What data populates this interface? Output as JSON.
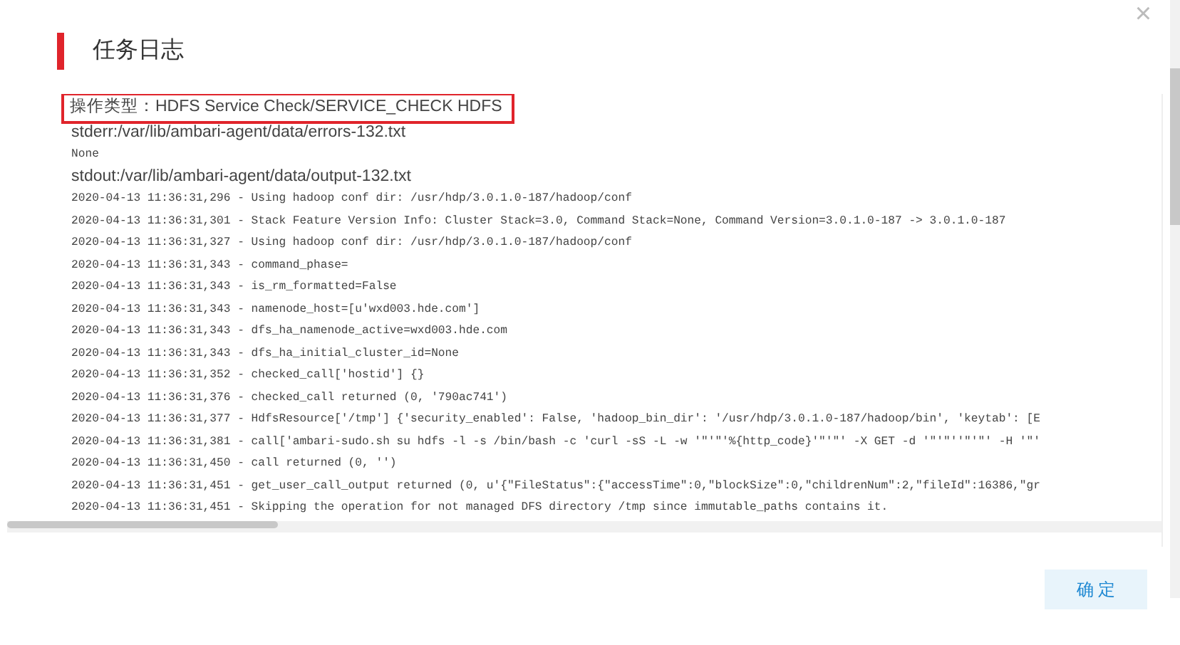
{
  "dialog": {
    "title": "任务日志",
    "close": "×"
  },
  "log": {
    "lines": [
      {
        "kind": "sans",
        "text": "操作类型：HDFS Service Check/SERVICE_CHECK HDFS",
        "highlighted": true
      },
      {
        "kind": "sans",
        "text": "stderr:/var/lib/ambari-agent/data/errors-132.txt",
        "highlighted": false
      },
      {
        "kind": "mono",
        "text": "None",
        "highlighted": false
      },
      {
        "kind": "sans",
        "text": "stdout:/var/lib/ambari-agent/data/output-132.txt",
        "highlighted": false
      },
      {
        "kind": "mono",
        "text": "2020-04-13 11:36:31,296 - Using hadoop conf dir: /usr/hdp/3.0.1.0-187/hadoop/conf",
        "highlighted": false
      },
      {
        "kind": "mono",
        "text": "2020-04-13 11:36:31,301 - Stack Feature Version Info: Cluster Stack=3.0, Command Stack=None, Command Version=3.0.1.0-187 -> 3.0.1.0-187",
        "highlighted": false
      },
      {
        "kind": "mono",
        "text": "2020-04-13 11:36:31,327 - Using hadoop conf dir: /usr/hdp/3.0.1.0-187/hadoop/conf",
        "highlighted": false
      },
      {
        "kind": "mono",
        "text": "2020-04-13 11:36:31,343 - command_phase=",
        "highlighted": false
      },
      {
        "kind": "mono",
        "text": "2020-04-13 11:36:31,343 - is_rm_formatted=False",
        "highlighted": false
      },
      {
        "kind": "mono",
        "text": "2020-04-13 11:36:31,343 - namenode_host=[u'wxd003.hde.com']",
        "highlighted": false
      },
      {
        "kind": "mono",
        "text": "2020-04-13 11:36:31,343 - dfs_ha_namenode_active=wxd003.hde.com",
        "highlighted": false
      },
      {
        "kind": "mono",
        "text": "2020-04-13 11:36:31,343 - dfs_ha_initial_cluster_id=None",
        "highlighted": false
      },
      {
        "kind": "mono",
        "text": "2020-04-13 11:36:31,352 - checked_call['hostid'] {}",
        "highlighted": false
      },
      {
        "kind": "mono",
        "text": "2020-04-13 11:36:31,376 - checked_call returned (0, '790ac741')",
        "highlighted": false
      },
      {
        "kind": "mono",
        "text": "2020-04-13 11:36:31,377 - HdfsResource['/tmp'] {'security_enabled': False, 'hadoop_bin_dir': '/usr/hdp/3.0.1.0-187/hadoop/bin', 'keytab': [E",
        "highlighted": false
      },
      {
        "kind": "mono",
        "text": "2020-04-13 11:36:31,381 - call['ambari-sudo.sh su hdfs -l -s /bin/bash -c 'curl -sS -L -w '\"'\"'%{http_code}'\"'\"' -X GET -d '\"'\"''\"'\"' -H '\"'",
        "highlighted": false
      },
      {
        "kind": "mono",
        "text": "2020-04-13 11:36:31,450 - call returned (0, '')",
        "highlighted": false
      },
      {
        "kind": "mono",
        "text": "2020-04-13 11:36:31,451 - get_user_call_output returned (0, u'{\"FileStatus\":{\"accessTime\":0,\"blockSize\":0,\"childrenNum\":2,\"fileId\":16386,\"gr",
        "highlighted": false
      },
      {
        "kind": "mono",
        "text": "2020-04-13 11:36:31,451 - Skipping the operation for not managed DFS directory /tmp since immutable_paths contains it.",
        "highlighted": false
      }
    ]
  },
  "buttons": [
    {
      "label": "确 定"
    }
  ]
}
